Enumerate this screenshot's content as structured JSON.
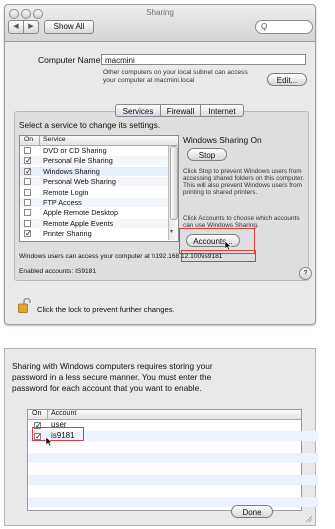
{
  "window": {
    "title": "Sharing",
    "show_all": "Show All",
    "nav_back": "◀",
    "nav_fwd": "▶",
    "search_placeholder": "Q"
  },
  "computer": {
    "label": "Computer Name:",
    "value": "macmini",
    "info_line1": "Other computers on your local subnet can access",
    "info_line2": "your computer at macmini.local",
    "edit_button": "Edit..."
  },
  "tabs": [
    "Services",
    "Firewall",
    "Internet"
  ],
  "services": {
    "prompt": "Select a service to change its settings.",
    "col_on": "On",
    "col_service": "Service",
    "items": [
      {
        "name": "DVD or CD Sharing",
        "checked": false,
        "mark": ""
      },
      {
        "name": "Personal File Sharing",
        "checked": true,
        "mark": "✓"
      },
      {
        "name": "Windows Sharing",
        "checked": true,
        "mark": "✓",
        "selected": true
      },
      {
        "name": "Personal Web Sharing",
        "checked": false,
        "mark": ""
      },
      {
        "name": "Remote Login",
        "checked": false,
        "mark": ""
      },
      {
        "name": "FTP Access",
        "checked": false,
        "mark": ""
      },
      {
        "name": "Apple Remote Desktop",
        "checked": false,
        "mark": ""
      },
      {
        "name": "Remote Apple Events",
        "checked": false,
        "mark": ""
      },
      {
        "name": "Printer Sharing",
        "checked": true,
        "mark": "✓"
      }
    ]
  },
  "detail": {
    "status": "Windows Sharing On",
    "stop_button": "Stop",
    "stop_help_1": "Click Stop to prevent Windows users from",
    "stop_help_2": "accessing shared folders on this computer.",
    "stop_help_3": "This will also prevent Windows users from",
    "stop_help_4": "printing to shared printers.",
    "accounts_help_1": "Click Accounts to choose which accounts",
    "accounts_help_2": "can use Windows Sharing.",
    "accounts_button": "Accounts..."
  },
  "footer": {
    "access_prefix": "Windows users can access your computer at ",
    "access_address": "\\\\192.168.12.100\\is9181",
    "enabled": "Enabled accounts: IS9181",
    "help": "?",
    "lock_text": "Click the lock to prevent further changes."
  },
  "sheet": {
    "message_1": "Sharing with Windows computers requires storing your",
    "message_2": "password in a less secure manner.  You must enter the",
    "message_3": "password for each account that you want to enable.",
    "col_on": "On",
    "col_account": "Account",
    "accounts": [
      {
        "name": "user",
        "mark": "✓"
      },
      {
        "name": "is9181",
        "mark": "✓"
      }
    ],
    "done_button": "Done"
  },
  "colors": {
    "highlight": "#e0393e"
  }
}
